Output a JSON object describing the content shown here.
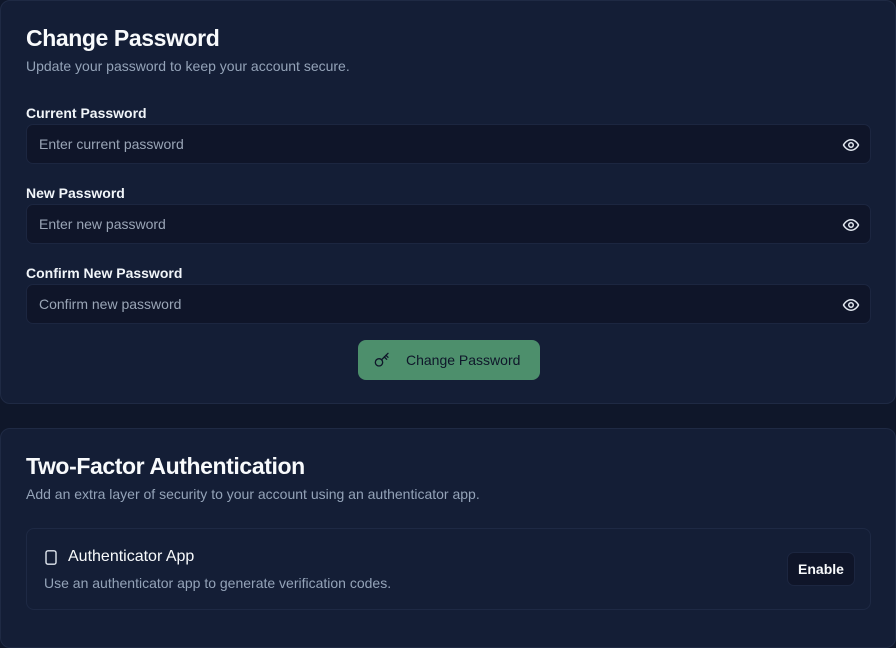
{
  "change_password": {
    "title": "Change Password",
    "description": "Update your password to keep your account secure.",
    "fields": [
      {
        "label": "Current Password",
        "placeholder": "Enter current password",
        "value": ""
      },
      {
        "label": "New Password",
        "placeholder": "Enter new password",
        "value": ""
      },
      {
        "label": "Confirm New Password",
        "placeholder": "Confirm new password",
        "value": ""
      }
    ],
    "submit_label": "Change Password",
    "submit_icon": "key-icon",
    "field_toggle_icon": "eye-icon"
  },
  "two_factor": {
    "title": "Two-Factor Authentication",
    "description": "Add an extra layer of security to your account using an authenticator app.",
    "method": {
      "icon": "smartphone-icon",
      "title": "Authenticator App",
      "description": "Use an authenticator app to generate verification codes.",
      "action_label": "Enable"
    }
  },
  "colors": {
    "background": "#0f172a",
    "card": "#141e36",
    "accent_button": "#4d8f6c",
    "muted_text": "#94a3b8"
  }
}
